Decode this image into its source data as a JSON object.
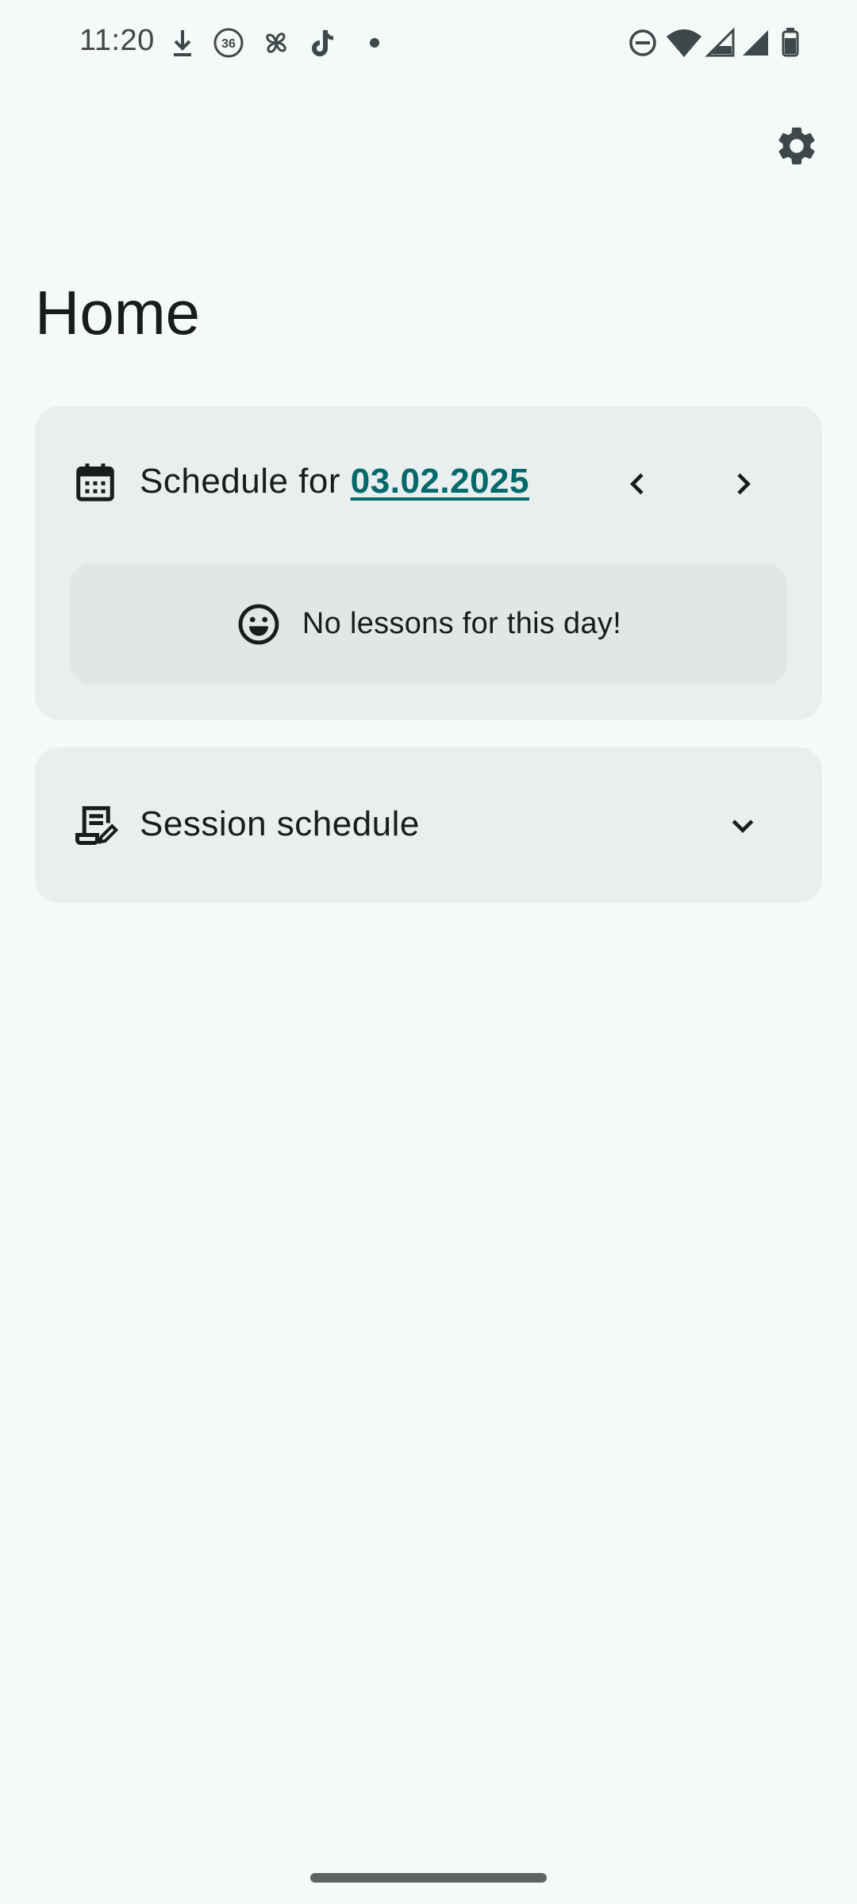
{
  "status_bar": {
    "time": "11:20",
    "left_icons": [
      "download-icon",
      "36-badge-icon",
      "pinwheel-icon",
      "tiktok-icon",
      "dot-icon"
    ],
    "right_icons": [
      "dnd-icon",
      "wifi-icon",
      "signal-icon",
      "signal-icon",
      "battery-icon"
    ]
  },
  "header": {
    "settings_icon": "gear-icon"
  },
  "page": {
    "title": "Home"
  },
  "schedule": {
    "icon": "calendar-icon",
    "label_prefix": "Schedule for ",
    "date": "03.02.2025",
    "prev_icon": "chevron-left-icon",
    "next_icon": "chevron-right-icon",
    "empty_icon": "smiley-icon",
    "empty_message": "No lessons for this day!"
  },
  "session": {
    "icon": "script-edit-icon",
    "label": "Session schedule",
    "expand_icon": "chevron-down-icon"
  },
  "colors": {
    "background": "#f4f9f9",
    "card": "#e9eeee",
    "inner_card": "#e1e6e6",
    "accent": "#00696b",
    "text": "#161d1d"
  }
}
